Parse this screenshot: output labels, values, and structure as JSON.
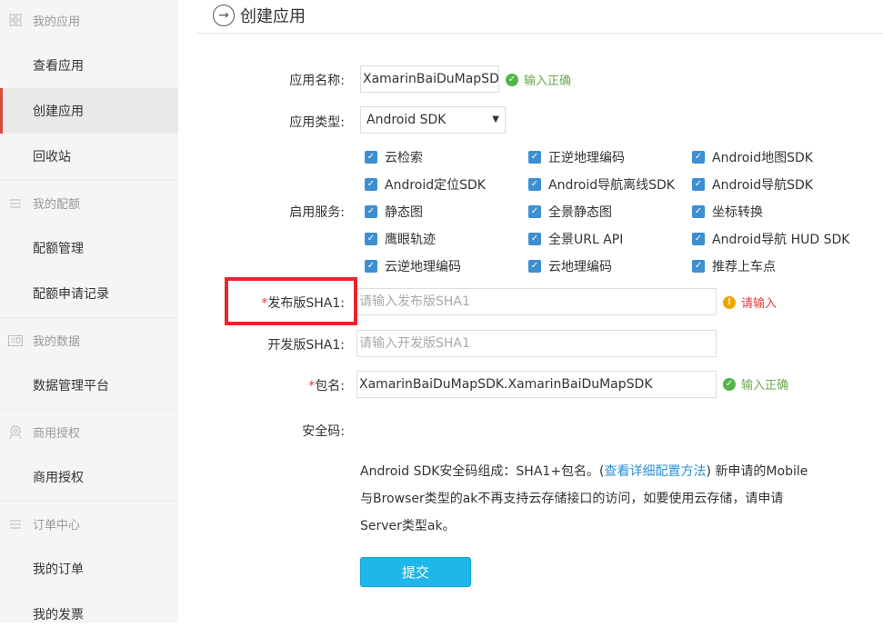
{
  "sidebar": {
    "groups": [
      {
        "title": "我的应用",
        "icon": "grid-icon",
        "items": [
          "查看应用",
          "创建应用",
          "回收站"
        ]
      },
      {
        "title": "我的配额",
        "icon": "list-icon",
        "items": [
          "配额管理",
          "配额申请记录"
        ]
      },
      {
        "title": "我的数据",
        "icon": "id-card-icon",
        "items": [
          "数据管理平台"
        ]
      },
      {
        "title": "商用授权",
        "icon": "badge-icon",
        "items": [
          "商用授权"
        ]
      },
      {
        "title": "订单中心",
        "icon": "list-icon",
        "items": [
          "我的订单",
          "我的发票"
        ]
      }
    ],
    "active_item": "创建应用"
  },
  "header": {
    "title": "创建应用"
  },
  "form": {
    "app_name": {
      "label": "应用名称:",
      "value": "XamarinBaiDuMapSDK",
      "status": "输入正确"
    },
    "app_type": {
      "label": "应用类型:",
      "value": "Android SDK"
    },
    "services": {
      "label": "启用服务:",
      "items": [
        "云检索",
        "正逆地理编码",
        "Android地图SDK",
        "Android定位SDK",
        "Android导航离线SDK",
        "Android导航SDK",
        "静态图",
        "全景静态图",
        "坐标转换",
        "鹰眼轨迹",
        "全景URL API",
        "Android导航 HUD SDK",
        "云逆地理编码",
        "云地理编码",
        "推荐上车点"
      ]
    },
    "release_sha1": {
      "required": "*",
      "label": "发布版SHA1:",
      "placeholder": "请输入发布版SHA1",
      "status": "请输入"
    },
    "dev_sha1": {
      "label": "开发版SHA1:",
      "placeholder": "请输入开发版SHA1"
    },
    "package": {
      "required": "*",
      "label": "包名:",
      "value": "XamarinBaiDuMapSDK.XamarinBaiDuMapSDK",
      "status": "输入正确"
    },
    "security_code": {
      "label": "安全码:"
    },
    "note": {
      "line1_a": "Android SDK安全码组成：SHA1+包名。(",
      "line1_link": "查看详细配置方法",
      "line1_b": ") 新申请的Mobile",
      "line2": "与Browser类型的ak不再支持云存储接口的访问，如要使用云存储，请申请",
      "line3": "Server类型ak。"
    },
    "submit_label": "提交"
  },
  "colors": {
    "accent_blue": "#1fb6e8",
    "checkbox_blue": "#3d8fd1",
    "ok_green": "#6aa84f",
    "error_red": "#e4393c",
    "highlight_red": "#e8262c"
  }
}
